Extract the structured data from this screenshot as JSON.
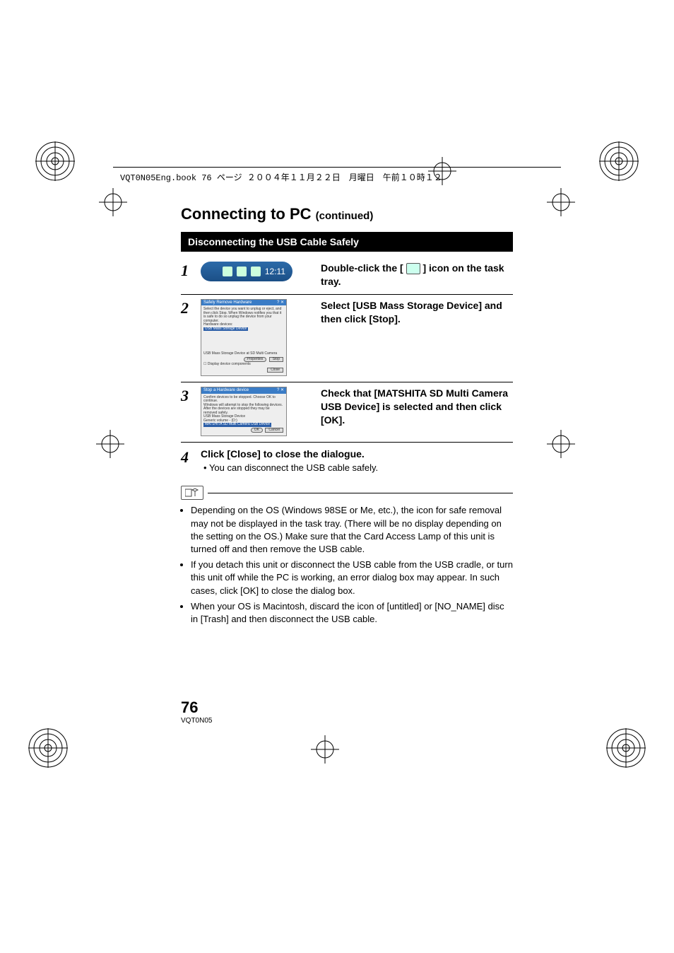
{
  "header": {
    "text": "VQT0N05Eng.book  76 ページ  ２００４年１１月２２日　月曜日　午前１０時１２"
  },
  "title": {
    "main": "Connecting to PC",
    "cont": "(continued)"
  },
  "section_heading": "Disconnecting the USB Cable Safely",
  "steps": {
    "s1": {
      "num": "1",
      "text_pre": "Double-click the [",
      "text_post": "] icon on the task tray.",
      "tray_time": "12:11"
    },
    "s2": {
      "num": "2",
      "text": "Select [USB Mass Storage Device] and then click [Stop].",
      "win_title": "Safely Remove Hardware",
      "win_msg": "Select the device you want to unplug or eject, and then click Stop. When Windows notifies you that it is safe to do so unplug the device from your computer.",
      "win_hw_label": "Hardware devices:",
      "win_sel": "USB Mass Storage Device",
      "win_sub": "USB Mass Storage Device at SD Multi Camera",
      "win_btn_props": "Properties",
      "win_btn_stop": "Stop",
      "win_chk": "Display device components",
      "win_btn_close": "Close"
    },
    "s3": {
      "num": "3",
      "text": "Check that [MATSHITA SD Multi Camera USB Device] is selected and then click [OK].",
      "win_title": "Stop a Hardware device",
      "win_msg": "Confirm devices to be stopped. Choose OK to continue.",
      "win_msg2": "Windows will attempt to stop the following devices. After the devices are stopped they may be removed safely.",
      "win_dev1": "USB Mass Storage Device",
      "win_dev2": "Generic volume - (D:)",
      "win_sel": "MATSHITA SD Multi Camera USB Device",
      "win_btn_ok": "OK",
      "win_btn_cancel": "Cancel"
    },
    "s4": {
      "num": "4",
      "heading": "Click [Close] to close the dialogue.",
      "sub_bullet": "•",
      "sub": "You can disconnect the USB cable safely."
    }
  },
  "notes": {
    "n1": "Depending on the OS (Windows 98SE or Me, etc.), the icon for safe removal may not be displayed in the task tray. (There will be no display depending on the setting on the OS.) Make sure that the Card Access Lamp of this unit is turned off and then remove the USB cable.",
    "n2": "If you detach this unit or disconnect the USB cable from the USB cradle, or turn this unit off while the PC is working, an error dialog box may appear. In such cases, click [OK] to close the dialog box.",
    "n3": "When your OS is Macintosh, discard the icon of [untitled] or [NO_NAME] disc in [Trash] and then disconnect the USB cable."
  },
  "footer": {
    "page": "76",
    "code": "VQT0N05"
  }
}
